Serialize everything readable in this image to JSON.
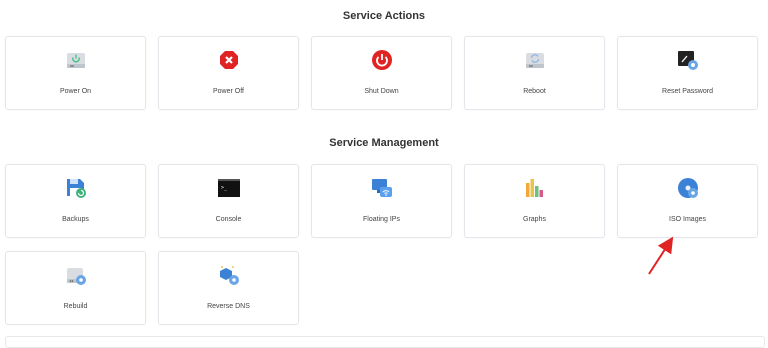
{
  "sections": {
    "actions_title": "Service Actions",
    "management_title": "Service Management"
  },
  "actions": [
    {
      "label": "Power On",
      "icon": "power-on-icon"
    },
    {
      "label": "Power Off",
      "icon": "power-off-icon"
    },
    {
      "label": "Shut Down",
      "icon": "shutdown-icon"
    },
    {
      "label": "Reboot",
      "icon": "reboot-icon"
    },
    {
      "label": "Reset Password",
      "icon": "reset-password-icon"
    }
  ],
  "management": [
    {
      "label": "Backups",
      "icon": "backups-icon"
    },
    {
      "label": "Console",
      "icon": "console-icon"
    },
    {
      "label": "Floating IPs",
      "icon": "floating-ips-icon"
    },
    {
      "label": "Graphs",
      "icon": "graphs-icon"
    },
    {
      "label": "ISO Images",
      "icon": "iso-images-icon"
    },
    {
      "label": "Rebuild",
      "icon": "rebuild-icon"
    },
    {
      "label": "Reverse DNS",
      "icon": "reverse-dns-icon"
    }
  ],
  "colors": {
    "accent_red": "#e02424",
    "accent_blue": "#3b82d6",
    "annotation_arrow": "#e02424"
  }
}
